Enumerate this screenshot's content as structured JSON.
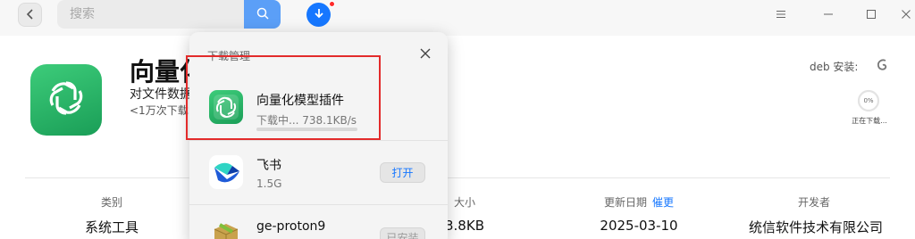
{
  "header": {
    "search_placeholder": "搜索",
    "back_icon": "chevron-left-icon",
    "search_icon": "search-icon",
    "download_icon": "download-arrow-icon",
    "download_badge_color": "#ff2a2a",
    "accent_color": "#1677ff"
  },
  "app": {
    "title": "向量化",
    "description": "对文件数据",
    "download_count": "<1万次下载",
    "icon": "openai-knot-icon",
    "deb_label": "deb 安装:",
    "deb_icon": "debian-swirl-icon",
    "progress_percent": "0%",
    "progress_value": 0,
    "progress_status": "正在下载..."
  },
  "info": {
    "category": {
      "label": "类别",
      "value": "系统工具"
    },
    "size": {
      "label": "大小",
      "value": "3.8KB"
    },
    "updated": {
      "label": "更新日期",
      "link": "催更",
      "value": "2025-03-10"
    },
    "developer": {
      "label": "开发者",
      "value": "统信软件技术有限公司"
    }
  },
  "download_manager": {
    "title": "下载管理",
    "items": [
      {
        "name": "向量化模型插件",
        "status": "下载中... 738.1KB/s",
        "icon": "openai-knot-icon",
        "progress": 0.0
      },
      {
        "name": "飞书",
        "status": "1.5G",
        "action": "打开",
        "icon": "feishu-bird-icon"
      },
      {
        "name": "ge-proton9",
        "action": "已安装",
        "icon": "package-box-icon"
      }
    ]
  }
}
